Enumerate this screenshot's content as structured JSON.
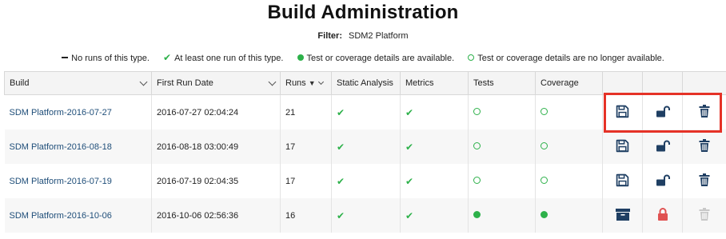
{
  "page": {
    "title": "Build Administration",
    "filter_label": "Filter:",
    "filter_value": "SDM2 Platform"
  },
  "legend": {
    "none": "No runs of this type.",
    "at_least_one": "At least one run of this type.",
    "available": "Test or coverage details are available.",
    "unavailable": "Test or coverage details are no longer available."
  },
  "table": {
    "headers": [
      "Build",
      "First Run Date",
      "Runs",
      "Static Analysis",
      "Metrics",
      "Tests",
      "Coverage"
    ],
    "rows": [
      {
        "build": "SDM Platform-2016-07-27",
        "date": "2016-07-27 02:04:24",
        "runs": "21",
        "static": "check",
        "metrics": "check",
        "tests": "open",
        "coverage": "open",
        "actions": [
          "save-icon",
          "unlock-icon",
          "trash-icon"
        ]
      },
      {
        "build": "SDM Platform-2016-08-18",
        "date": "2016-08-18 03:00:49",
        "runs": "17",
        "static": "check",
        "metrics": "check",
        "tests": "open",
        "coverage": "open",
        "actions": [
          "save-icon",
          "unlock-icon",
          "trash-icon"
        ]
      },
      {
        "build": "SDM Platform-2016-07-19",
        "date": "2016-07-19 02:04:35",
        "runs": "17",
        "static": "check",
        "metrics": "check",
        "tests": "open",
        "coverage": "open",
        "actions": [
          "save-icon",
          "unlock-icon",
          "trash-icon"
        ]
      },
      {
        "build": "SDM Platform-2016-10-06",
        "date": "2016-10-06 02:56:36",
        "runs": "16",
        "static": "check",
        "metrics": "check",
        "tests": "filled",
        "coverage": "filled",
        "actions": [
          "archive-icon",
          "lock-icon",
          "trash-disabled-icon"
        ]
      }
    ]
  },
  "colors": {
    "accent_green": "#2db14a",
    "icon_navy": "#1f3f63",
    "lock_red": "#e05252",
    "highlight_red": "#e53227",
    "disabled_gray": "#c8c8c8"
  }
}
